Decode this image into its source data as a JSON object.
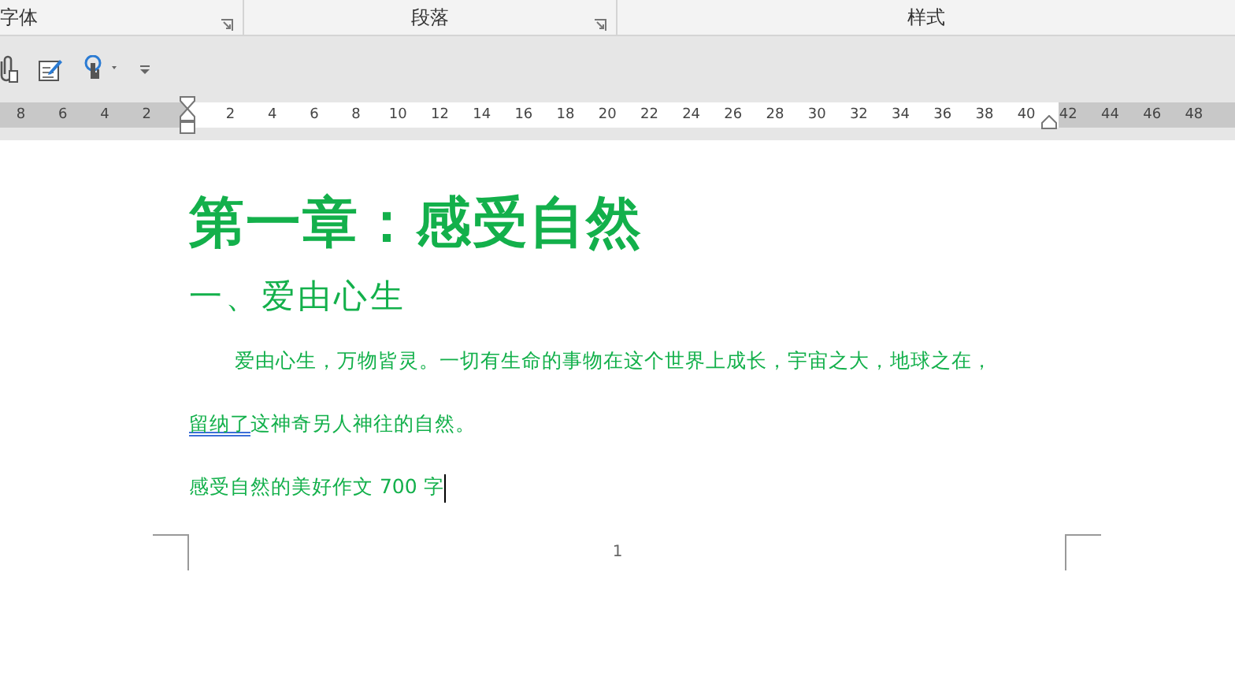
{
  "ribbon_groups": [
    {
      "label": "字体",
      "launcher": true
    },
    {
      "label": "段落",
      "launcher": true
    },
    {
      "label": "样式",
      "launcher": false
    }
  ],
  "quick_access": [
    {
      "kind": "attach"
    },
    {
      "kind": "edit"
    },
    {
      "kind": "touch"
    },
    {
      "kind": "customize"
    }
  ],
  "ruler": {
    "left_ticks": [
      "8",
      "6",
      "4",
      "2"
    ],
    "ticks": [
      "2",
      "4",
      "6",
      "8",
      "10",
      "12",
      "14",
      "16",
      "18",
      "20",
      "22",
      "24",
      "26",
      "28",
      "30",
      "32",
      "34",
      "36",
      "38",
      "40"
    ],
    "right_ticks": [
      "42",
      "44",
      "46",
      "48"
    ]
  },
  "document": {
    "blocks": [
      {
        "kind": "heading1",
        "text": "第一章：感受自然"
      },
      {
        "kind": "heading2",
        "text": "一、爱由心生"
      },
      {
        "kind": "indented",
        "segments": [
          {
            "text": "爱由心生，万物皆灵。一切有生命的事物在这个世界上成长，宇宙之大，地球之在，",
            "spelling_error": false
          }
        ]
      },
      {
        "kind": "plain",
        "segments": [
          {
            "text": "留纳了",
            "spelling_error": true
          },
          {
            "text": "这神奇另人神往的自然。",
            "spelling_error": false
          }
        ]
      },
      {
        "kind": "plain",
        "cursor": true,
        "segments": [
          {
            "text": "感受自然的美好作文 700 字",
            "spelling_error": false
          }
        ]
      }
    ],
    "page_number": "1"
  }
}
